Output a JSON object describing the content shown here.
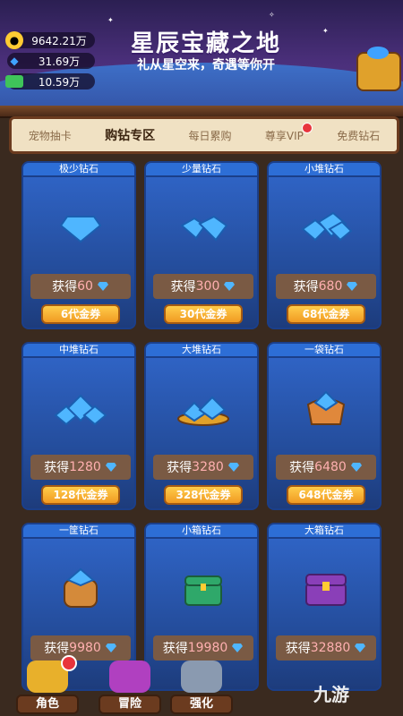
{
  "header": {
    "title": "星辰宝藏之地",
    "subtitle": "礼从星空来，奇遇等你开"
  },
  "currencies": [
    {
      "name": "gold-coin",
      "value": "9642.21万",
      "color": "#ffcc33"
    },
    {
      "name": "diamond",
      "value": "31.69万",
      "color": "#3fa2ff"
    },
    {
      "name": "cash",
      "value": "10.59万",
      "color": "#3fc45a"
    }
  ],
  "tabs": [
    {
      "label": "宠物抽卡",
      "active": false
    },
    {
      "label": "购钻专区",
      "active": true
    },
    {
      "label": "每日累购",
      "active": false
    },
    {
      "label": "尊享VIP",
      "active": false,
      "badge": true
    },
    {
      "label": "免费钻石",
      "active": false
    }
  ],
  "cards": [
    {
      "title": "极少钻石",
      "gain_prefix": "获得",
      "amount": "60",
      "price": "6代金券"
    },
    {
      "title": "少量钻石",
      "gain_prefix": "获得",
      "amount": "300",
      "price": "30代金券"
    },
    {
      "title": "小堆钻石",
      "gain_prefix": "获得",
      "amount": "680",
      "price": "68代金券"
    },
    {
      "title": "中堆钻石",
      "gain_prefix": "获得",
      "amount": "1280",
      "price": "128代金券"
    },
    {
      "title": "大堆钻石",
      "gain_prefix": "获得",
      "amount": "3280",
      "price": "328代金券"
    },
    {
      "title": "一袋钻石",
      "gain_prefix": "获得",
      "amount": "6480",
      "price": "648代金券"
    },
    {
      "title": "一筐钻石",
      "gain_prefix": "获得",
      "amount": "9980",
      "price": ""
    },
    {
      "title": "小箱钻石",
      "gain_prefix": "获得",
      "amount": "19980",
      "price": ""
    },
    {
      "title": "大箱钻石",
      "gain_prefix": "获得",
      "amount": "32880",
      "price": ""
    }
  ],
  "bottom_nav": [
    {
      "label": "角色",
      "badge": true
    },
    {
      "label": "冒险",
      "badge": false
    },
    {
      "label": "强化",
      "badge": false
    }
  ],
  "watermark": "九游"
}
